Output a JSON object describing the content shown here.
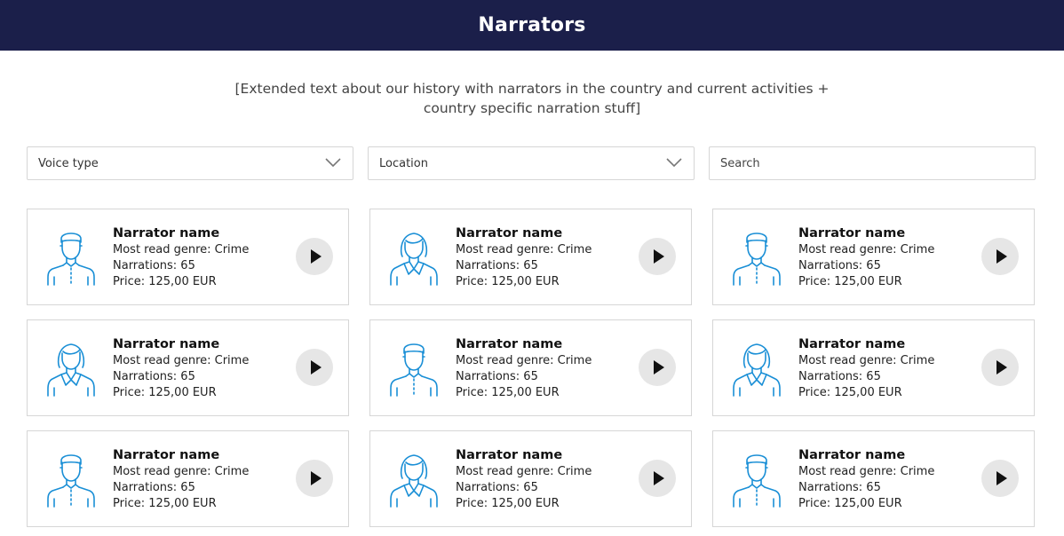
{
  "header": {
    "title": "Narrators"
  },
  "intro": {
    "line1": "[Extended text about our history with narrators in the country and current activities +",
    "line2": "country specific narration stuff]"
  },
  "filters": {
    "voice_type": "Voice type",
    "location": "Location",
    "search_placeholder": "Search"
  },
  "colors": {
    "header_bg": "#1b1f4a",
    "icon_blue": "#1a8fd6",
    "play_bg": "#e6e6e6"
  },
  "narrators": [
    {
      "name": "Narrator name",
      "genre": "Most read genre: Crime",
      "narrations": "Narrations: 65",
      "price": "Price: 125,00 EUR",
      "avatar": "male-avatar-icon"
    },
    {
      "name": "Narrator name",
      "genre": "Most read genre: Crime",
      "narrations": "Narrations: 65",
      "price": "Price: 125,00 EUR",
      "avatar": "female-avatar-icon"
    },
    {
      "name": "Narrator name",
      "genre": "Most read genre: Crime",
      "narrations": "Narrations: 65",
      "price": "Price: 125,00 EUR",
      "avatar": "male-avatar-icon"
    },
    {
      "name": "Narrator name",
      "genre": "Most read genre: Crime",
      "narrations": "Narrations: 65",
      "price": "Price: 125,00 EUR",
      "avatar": "female-avatar-icon"
    },
    {
      "name": "Narrator name",
      "genre": "Most read genre: Crime",
      "narrations": "Narrations: 65",
      "price": "Price: 125,00 EUR",
      "avatar": "male-avatar-icon"
    },
    {
      "name": "Narrator name",
      "genre": "Most read genre: Crime",
      "narrations": "Narrations: 65",
      "price": "Price: 125,00 EUR",
      "avatar": "female-avatar-icon"
    },
    {
      "name": "Narrator name",
      "genre": "Most read genre: Crime",
      "narrations": "Narrations: 65",
      "price": "Price: 125,00 EUR",
      "avatar": "male-avatar-icon"
    },
    {
      "name": "Narrator name",
      "genre": "Most read genre: Crime",
      "narrations": "Narrations: 65",
      "price": "Price: 125,00 EUR",
      "avatar": "female-avatar-icon"
    },
    {
      "name": "Narrator name",
      "genre": "Most read genre: Crime",
      "narrations": "Narrations: 65",
      "price": "Price: 125,00 EUR",
      "avatar": "male-avatar-icon"
    }
  ]
}
